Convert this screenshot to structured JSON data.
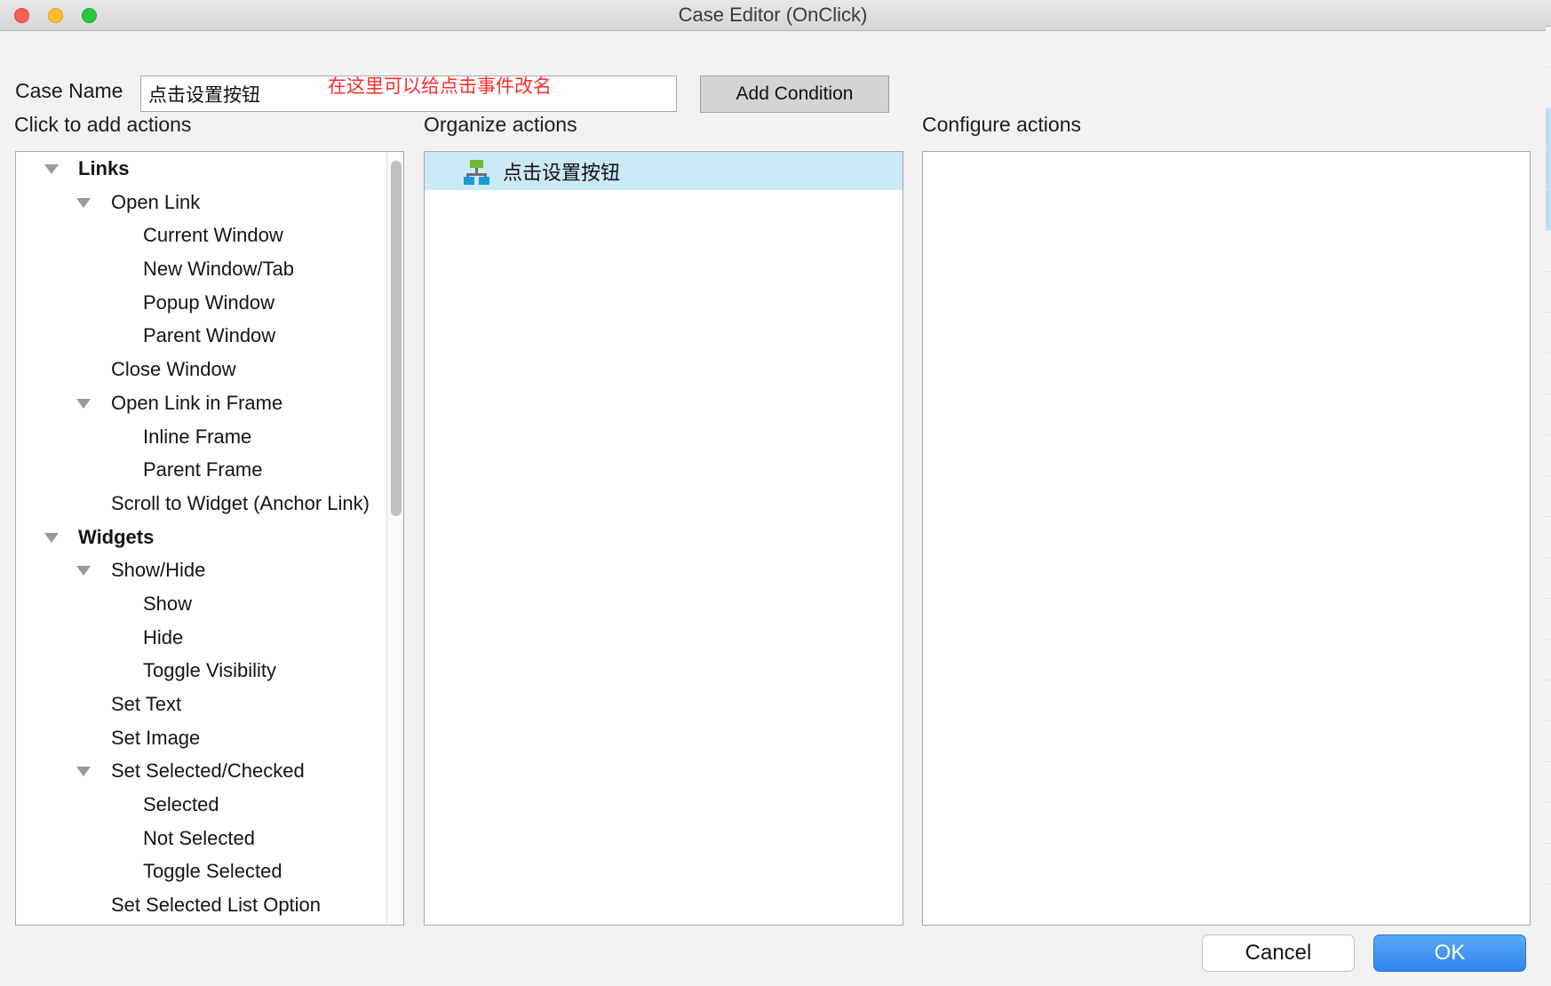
{
  "window": {
    "title": "Case Editor (OnClick)",
    "controls": {
      "close": "close-button",
      "minimize": "minimize-button",
      "zoom": "zoom-button"
    }
  },
  "case_name": {
    "label": "Case Name",
    "value": "点击设置按钮",
    "placeholder": ""
  },
  "annotation": {
    "text": "在这里可以给点击事件改名",
    "color": "#ff2b2b"
  },
  "toolbar": {
    "add_condition_label": "Add Condition"
  },
  "columns": {
    "left_header": "Click to add actions",
    "middle_header": "Organize actions",
    "right_header": "Configure actions"
  },
  "tree": {
    "items": [
      {
        "label": "Links",
        "level": 0,
        "caret": true,
        "bold": true
      },
      {
        "label": "Open Link",
        "level": 1,
        "caret": true,
        "bold": false
      },
      {
        "label": "Current Window",
        "level": 2,
        "caret": false,
        "bold": false
      },
      {
        "label": "New Window/Tab",
        "level": 2,
        "caret": false,
        "bold": false
      },
      {
        "label": "Popup Window",
        "level": 2,
        "caret": false,
        "bold": false
      },
      {
        "label": "Parent Window",
        "level": 2,
        "caret": false,
        "bold": false
      },
      {
        "label": "Close Window",
        "level": 1,
        "caret": false,
        "bold": false
      },
      {
        "label": "Open Link in Frame",
        "level": 1,
        "caret": true,
        "bold": false
      },
      {
        "label": "Inline Frame",
        "level": 2,
        "caret": false,
        "bold": false
      },
      {
        "label": "Parent Frame",
        "level": 2,
        "caret": false,
        "bold": false
      },
      {
        "label": "Scroll to Widget (Anchor Link)",
        "level": 1,
        "caret": false,
        "bold": false
      },
      {
        "label": "Widgets",
        "level": 0,
        "caret": true,
        "bold": true
      },
      {
        "label": "Show/Hide",
        "level": 1,
        "caret": true,
        "bold": false
      },
      {
        "label": "Show",
        "level": 2,
        "caret": false,
        "bold": false
      },
      {
        "label": "Hide",
        "level": 2,
        "caret": false,
        "bold": false
      },
      {
        "label": "Toggle Visibility",
        "level": 2,
        "caret": false,
        "bold": false
      },
      {
        "label": "Set Text",
        "level": 1,
        "caret": false,
        "bold": false
      },
      {
        "label": "Set Image",
        "level": 1,
        "caret": false,
        "bold": false
      },
      {
        "label": "Set Selected/Checked",
        "level": 1,
        "caret": true,
        "bold": false
      },
      {
        "label": "Selected",
        "level": 2,
        "caret": false,
        "bold": false
      },
      {
        "label": "Not Selected",
        "level": 2,
        "caret": false,
        "bold": false
      },
      {
        "label": "Toggle Selected",
        "level": 2,
        "caret": false,
        "bold": false
      },
      {
        "label": "Set Selected List Option",
        "level": 1,
        "caret": false,
        "bold": false
      }
    ]
  },
  "organize": {
    "actions": [
      {
        "label": "点击设置按钮",
        "icon": "sitemap-icon",
        "selected": true
      }
    ]
  },
  "configure": {
    "content": ""
  },
  "footer": {
    "cancel_label": "Cancel",
    "ok_label": "OK"
  },
  "colors": {
    "selection": "#cce9f7",
    "ok_button": "#2f83ef",
    "annotation": "#ff2b2b",
    "icon_green": "#74b72c",
    "icon_blue": "#1b9ad6"
  }
}
